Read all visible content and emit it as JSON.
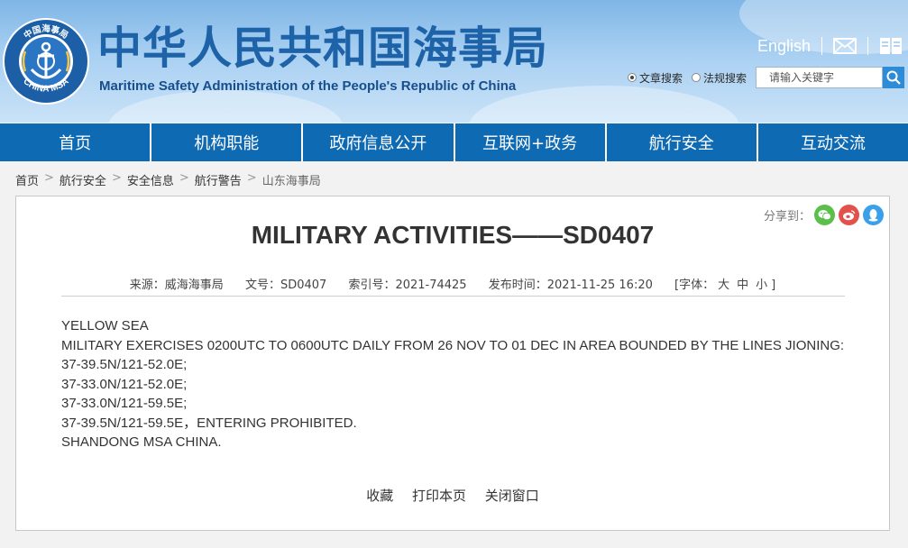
{
  "header": {
    "logo_text_top": "中国海事局",
    "logo_text_bottom": "CHINA MSA",
    "title_cn": "中华人民共和国海事局",
    "title_en": "Maritime Safety Administration of the People's Republic of China",
    "english_link": "English",
    "search": {
      "option_article": "文章搜索",
      "option_law": "法规搜索",
      "placeholder": "请输入关键字"
    }
  },
  "nav": {
    "items": [
      "首页",
      "机构职能",
      "政府信息公开",
      "互联网+政务",
      "航行安全",
      "互动交流"
    ]
  },
  "breadcrumb": [
    "首页",
    "航行安全",
    "安全信息",
    "航行警告",
    "山东海事局"
  ],
  "article": {
    "share_label": "分享到：",
    "title": "MILITARY ACTIVITIES——SD0407",
    "meta": {
      "source": "来源：威海海事局",
      "doc_no": "文号：SD0407",
      "index_no": "索引号：2021-74425",
      "published": "发布时间：2021-11-25 16:20",
      "font_label": "[字体：",
      "font_large": "大",
      "font_medium": "中",
      "font_small": "小",
      "font_close": "]"
    },
    "body": [
      "YELLOW SEA",
      "MILITARY EXERCISES 0200UTC TO 0600UTC DAILY FROM 26 NOV TO 01 DEC IN AREA BOUNDED BY THE LINES JIONING:",
      "37-39.5N/121-52.0E;",
      "37-33.0N/121-52.0E;",
      "37-33.0N/121-59.5E;",
      "37-39.5N/121-59.5E，ENTERING PROHIBITED.",
      "SHANDONG MSA CHINA."
    ],
    "actions": {
      "favorite": "收藏",
      "print": "打印本页",
      "close": "关闭窗口"
    }
  },
  "colors": {
    "nav_blue": "#0f6ab4",
    "title_blue": "#1e63a8",
    "wechat_green": "#5bbf4a",
    "weibo_red": "#e2514a",
    "qq_blue": "#3aa0ea"
  }
}
